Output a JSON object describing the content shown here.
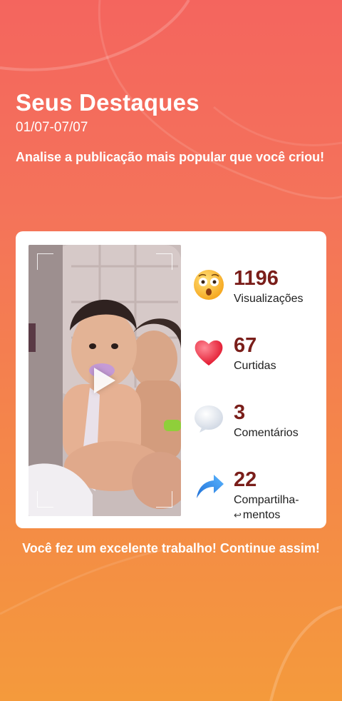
{
  "header": {
    "title": "Seus Destaques",
    "date_range": "01/07-07/07",
    "subtitle": "Analise a publicação mais popular que você criou!"
  },
  "video": {
    "thumbnail": "two-babies-on-chair-photo",
    "play_icon": "play-icon"
  },
  "stats": [
    {
      "icon": "surprised-face-icon",
      "value": "1196",
      "label": "Visualizações"
    },
    {
      "icon": "heart-icon",
      "value": "67",
      "label": "Curtidas"
    },
    {
      "icon": "speech-bubble-icon",
      "value": "3",
      "label": "Comentários"
    },
    {
      "icon": "share-arrow-icon",
      "value": "22",
      "label_line1": "Compartilha-",
      "label_line2": "mentos"
    }
  ],
  "footer": {
    "message": "Você fez um excelente trabalho! Continue assim!"
  },
  "colors": {
    "background_top": "#f4655e",
    "background_bottom": "#f49a3c",
    "stat_value": "#7a1e1a"
  }
}
